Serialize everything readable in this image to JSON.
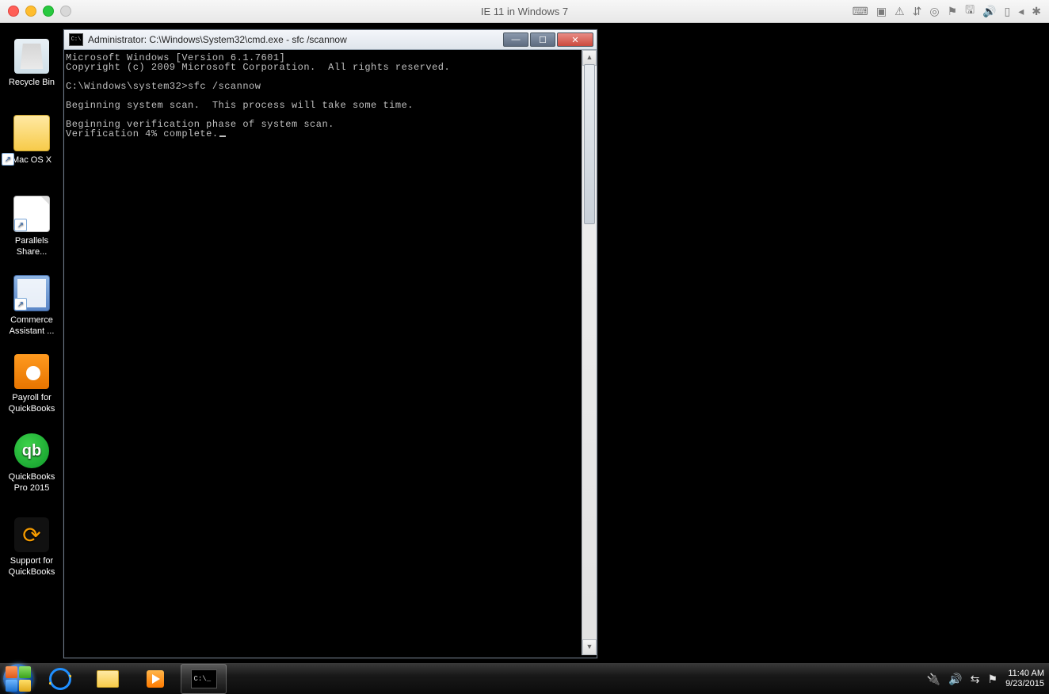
{
  "mac": {
    "title": "IE 11 in Windows 7",
    "menu_icons": [
      "keyboard-icon",
      "display-icon",
      "warning-icon",
      "usb-icon",
      "camera-icon",
      "bluetooth-icon",
      "disk-icon",
      "sound-icon",
      "device-icon",
      "arrow-icon",
      "gear-icon"
    ]
  },
  "desktop_icons": [
    {
      "name": "recycle-bin",
      "label": "Recycle Bin"
    },
    {
      "name": "mac-osx-folder",
      "label": "Mac OS X"
    },
    {
      "name": "parallels-shared",
      "label": "Parallels Share..."
    },
    {
      "name": "commerce-assistant",
      "label": "Commerce Assistant ..."
    },
    {
      "name": "payroll-quickbooks",
      "label": "Payroll for QuickBooks"
    },
    {
      "name": "quickbooks-pro-2015",
      "label": "QuickBooks Pro 2015"
    },
    {
      "name": "support-quickbooks",
      "label": "Support for QuickBooks"
    }
  ],
  "cmd": {
    "title": "Administrator: C:\\Windows\\System32\\cmd.exe - sfc  /scannow",
    "icon_text": "C:\\",
    "lines": {
      "l1": "Microsoft Windows [Version 6.1.7601]",
      "l2": "Copyright (c) 2009 Microsoft Corporation.  All rights reserved.",
      "l3": "",
      "l4": "C:\\Windows\\system32>sfc /scannow",
      "l5": "",
      "l6": "Beginning system scan.  This process will take some time.",
      "l7": "",
      "l8": "Beginning verification phase of system scan.",
      "l9": "Verification 4% complete."
    }
  },
  "taskbar": {
    "pinned": [
      {
        "name": "start",
        "label": "Start"
      },
      {
        "name": "internet-explorer",
        "label": "Internet Explorer"
      },
      {
        "name": "file-explorer",
        "label": "Windows Explorer"
      },
      {
        "name": "windows-media-player",
        "label": "Windows Media Player"
      },
      {
        "name": "command-prompt",
        "label": "Command Prompt",
        "active": true
      }
    ],
    "cmd_icon_text": "C:\\_",
    "tray": {
      "power": "power-icon",
      "volume": "volume-icon",
      "network": "network-icon",
      "flag": "action-center-icon",
      "time": "11:40 AM",
      "date": "9/23/2015"
    }
  }
}
